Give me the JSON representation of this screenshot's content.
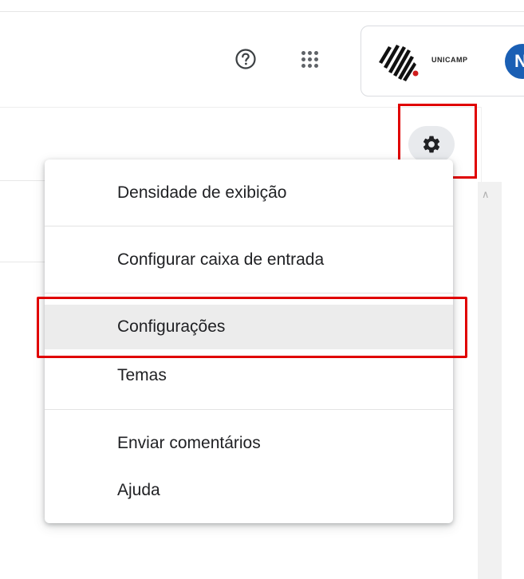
{
  "header": {
    "help_icon": "help-circle-icon",
    "apps_icon": "apps-grid-icon",
    "account": {
      "logo_text": "UNICAMP",
      "avatar_letter": "N"
    }
  },
  "settings_button": {
    "icon": "gear-icon"
  },
  "settings_menu": {
    "items": [
      {
        "label": "Densidade de exibição"
      },
      {
        "label": "Configurar caixa de entrada"
      },
      {
        "label": "Configurações",
        "highlighted": true
      },
      {
        "label": "Temas"
      },
      {
        "label": "Enviar comentários"
      },
      {
        "label": "Ajuda"
      }
    ]
  },
  "colors": {
    "highlight_box": "#e00000",
    "avatar_bg": "#1a5fb4",
    "selected_item_bg": "#ececec"
  }
}
